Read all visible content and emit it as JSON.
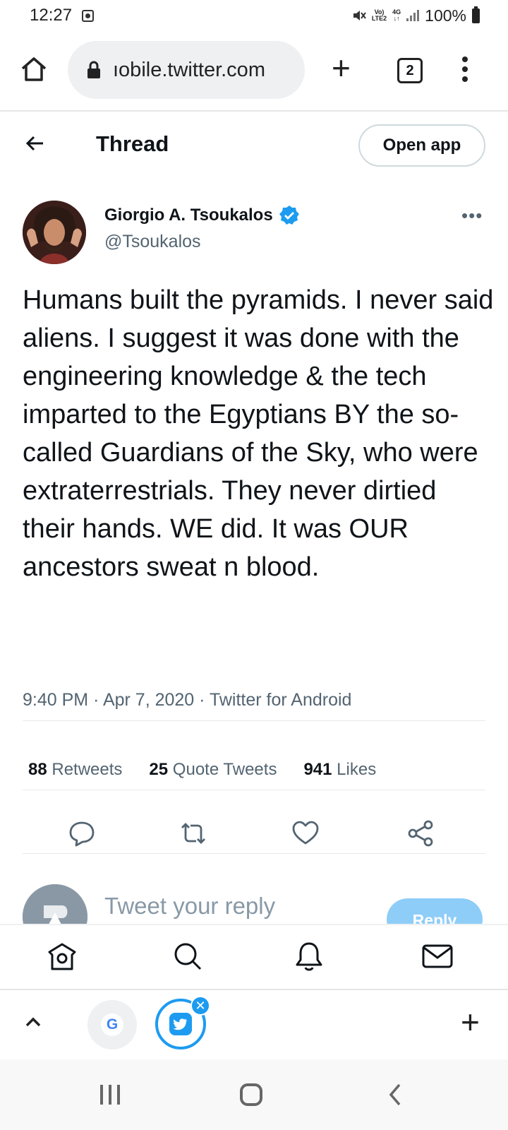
{
  "status_bar": {
    "time": "12:27",
    "network_top": "Vo)",
    "network_bottom": "LTE2",
    "network_type": "4G",
    "battery": "100%"
  },
  "browser": {
    "url": "ıobile.twitter.com",
    "tab_count": "2"
  },
  "header": {
    "title": "Thread",
    "open_app": "Open app"
  },
  "tweet": {
    "author_name": "Giorgio A. Tsoukalos",
    "handle": "@Tsoukalos",
    "text": "Humans built the pyramids. I never said aliens. I suggest it was done with the engineering knowledge & the tech imparted to the Egyptians BY the so-called Guardians of the Sky, who were extraterrestrials. They never dirtied their hands. WE did. It was OUR ancestors sweat n blood.",
    "meta": "9:40 PM · Apr 7, 2020 · Twitter for Android",
    "stats": [
      {
        "count": "88",
        "label": "Retweets"
      },
      {
        "count": "25",
        "label": "Quote Tweets"
      },
      {
        "count": "941",
        "label": "Likes"
      }
    ]
  },
  "reply": {
    "placeholder": "Tweet your reply",
    "button": "Reply"
  },
  "bottom_tabs": {
    "google_letter": "G"
  },
  "colors": {
    "accent": "#1d9bf0",
    "reply_button_disabled": "#8ecdf8",
    "secondary_text": "#536471"
  }
}
